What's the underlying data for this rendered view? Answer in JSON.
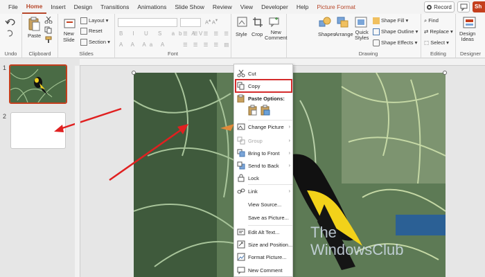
{
  "menu": {
    "tabs": [
      "File",
      "Home",
      "Insert",
      "Design",
      "Transitions",
      "Animations",
      "Slide Show",
      "Review",
      "View",
      "Developer",
      "Help",
      "Picture Format"
    ],
    "active": "Home",
    "record_label": "Record",
    "share_label": "Sh"
  },
  "ribbon": {
    "undo_group": "Undo",
    "clipboard_group": "Clipboard",
    "paste_label": "Paste",
    "slides_group": "Slides",
    "new_slide_label": "New\nSlide",
    "layout_label": "Layout",
    "reset_label": "Reset",
    "section_label": "Section",
    "font_group": "Font",
    "style_label": "Style",
    "crop_label": "Crop",
    "new_comment_label": "New\nComment",
    "shapes_label": "Shapes",
    "arrange_label": "Arrange",
    "quick_styles_label": "Quick\nStyles",
    "shape_fill_label": "Shape Fill",
    "shape_outline_label": "Shape Outline",
    "shape_effects_label": "Shape Effects",
    "drawing_group": "Drawing",
    "find_label": "Find",
    "replace_label": "Replace",
    "select_label": "Select",
    "editing_group": "Editing",
    "design_ideas_label": "Design\nIdeas",
    "designer_group": "Designer"
  },
  "slides": [
    {
      "number": "1"
    },
    {
      "number": "2"
    }
  ],
  "context_menu": {
    "cut": "Cut",
    "copy": "Copy",
    "paste_options": "Paste Options:",
    "change_picture": "Change Picture",
    "group": "Group",
    "bring_to_front": "Bring to Front",
    "send_to_back": "Send to Back",
    "lock": "Lock",
    "link": "Link",
    "view_source": "View Source...",
    "save_as_picture": "Save as Picture...",
    "edit_alt_text": "Edit Alt Text...",
    "size_and_position": "Size and Position...",
    "format_picture": "Format Picture...",
    "new_comment": "New Comment"
  },
  "watermark": {
    "line1": "The",
    "line2": "WindowsClub"
  },
  "colors": {
    "accent": "#b7472a",
    "highlight": "#d42b2b"
  }
}
